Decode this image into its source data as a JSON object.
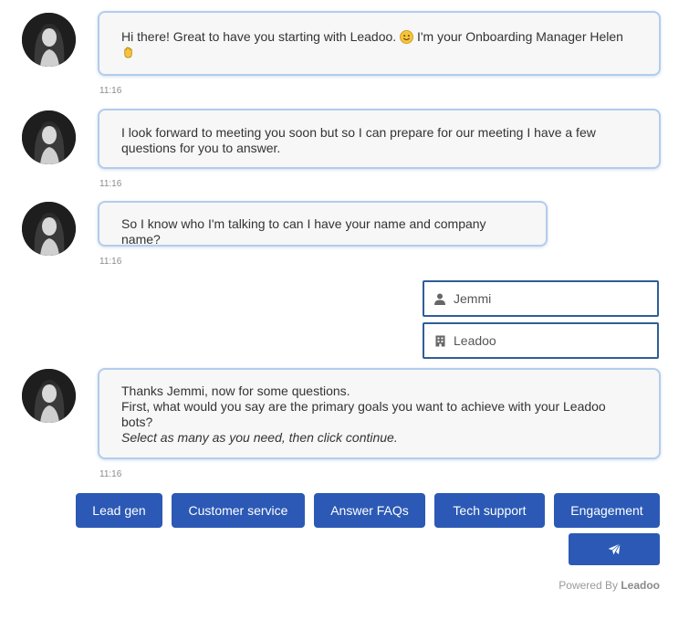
{
  "messages": [
    {
      "lines": [
        "Hi there! Great to have you starting with Leadoo. 😊  I'm your Onboarding Manager Helen",
        "👋"
      ],
      "line1_text": "Hi there! Great to have you starting with Leadoo. ",
      "line1_after_emoji": " I'm your Onboarding Manager Helen",
      "time": "11:16"
    },
    {
      "line1": "I look forward to meeting you soon but so I can prepare for our meeting I have a few",
      "line2": "questions for you to answer.",
      "time": "11:16"
    },
    {
      "line1": "So I know who I'm talking to can I have your name and company name?",
      "time": "11:16"
    },
    {
      "line1": "Thanks Jemmi, now for some questions.",
      "line2": "First, what would you say are the primary goals you want to achieve with your Leadoo",
      "line3": "bots?",
      "line4": "Select as many as you need, then click continue.",
      "time": "11:16"
    }
  ],
  "form": {
    "name_value": "Jemmi",
    "name_icon": "user-icon",
    "company_value": "Leadoo",
    "company_icon": "building-icon"
  },
  "options": [
    "Lead gen",
    "Customer service",
    "Answer FAQs",
    "Tech support",
    "Engagement"
  ],
  "send_icon": "paper-plane-icon",
  "footer": {
    "powered_by": "Powered By",
    "brand": "Leadoo"
  },
  "colors": {
    "accent": "#2b59b5",
    "bubble_border": "#b3cdec",
    "field_border": "#2f5e96"
  }
}
